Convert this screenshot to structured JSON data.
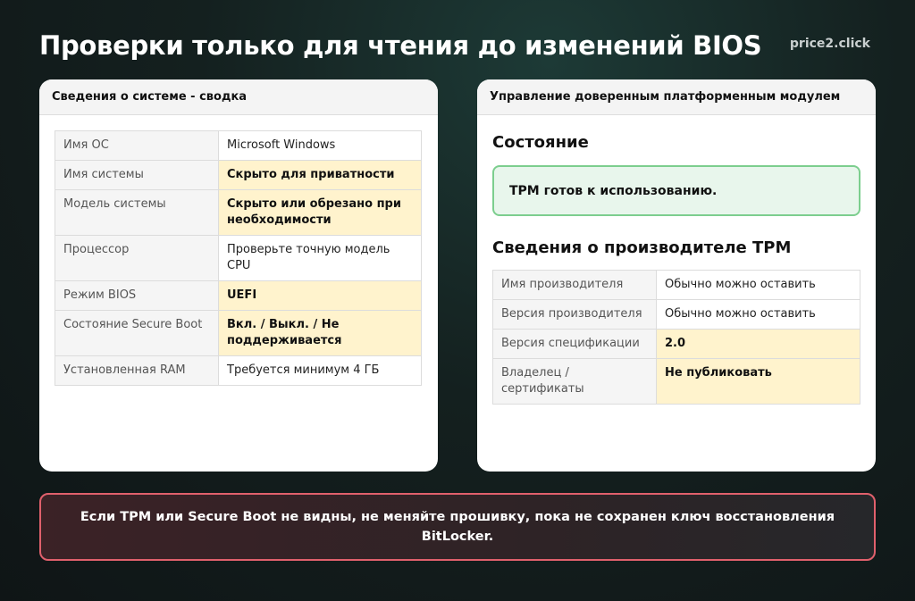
{
  "page": {
    "title": "Проверки только для чтения до изменений BIOS",
    "brand": "price2.click"
  },
  "system_summary": {
    "header": "Сведения о системе - сводка",
    "rows": [
      {
        "key": "Имя ОС",
        "value": "Microsoft Windows",
        "highlight": false
      },
      {
        "key": "Имя системы",
        "value": "Скрыто для приватности",
        "highlight": true
      },
      {
        "key": "Модель системы",
        "value": "Скрыто или обрезано при необходимости",
        "highlight": true
      },
      {
        "key": "Процессор",
        "value": "Проверьте точную модель CPU",
        "highlight": false
      },
      {
        "key": "Режим BIOS",
        "value": "UEFI",
        "highlight": true
      },
      {
        "key": "Состояние Secure Boot",
        "value": "Вкл. / Выкл. / Не поддерживается",
        "highlight": true
      },
      {
        "key": "Установленная RAM",
        "value": "Требуется минимум 4 ГБ",
        "highlight": false
      }
    ]
  },
  "tpm": {
    "header": "Управление доверенным платформенным модулем",
    "status_title": "Состояние",
    "status_text": "TPM готов к использованию.",
    "manufacturer_title": "Сведения о производителе TPM",
    "rows": [
      {
        "key": "Имя производителя",
        "value": "Обычно можно оставить",
        "highlight": false
      },
      {
        "key": "Версия производителя",
        "value": "Обычно можно оставить",
        "highlight": false
      },
      {
        "key": "Версия спецификации",
        "value": "2.0",
        "highlight": true
      },
      {
        "key": "Владелец / сертификаты",
        "value": "Не публиковать",
        "highlight": true
      }
    ]
  },
  "warning": {
    "text": "Если TPM или Secure Boot не видны, не меняйте прошивку, пока не сохранен ключ восстановления BitLocker."
  },
  "colors": {
    "highlight_bg": "#fff3cd",
    "status_bg": "#e8f6ec",
    "status_border": "#7cce8e",
    "warning_border": "#e0606c"
  }
}
